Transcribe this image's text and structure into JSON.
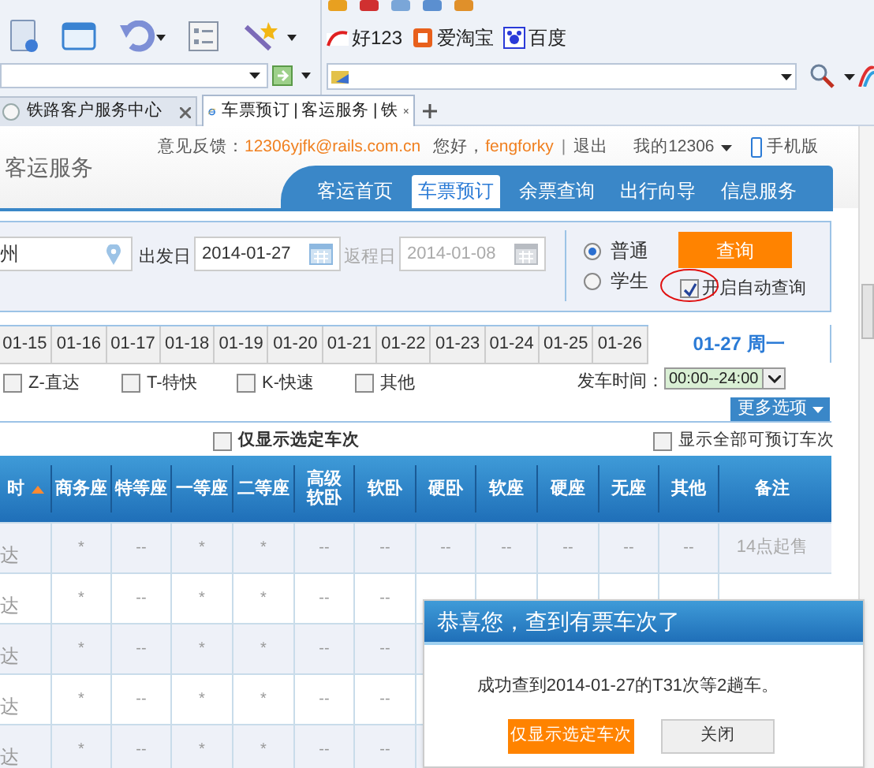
{
  "browser": {
    "links": [
      {
        "label": "好123"
      },
      {
        "label": "爱淘宝"
      },
      {
        "label": "百度"
      }
    ],
    "tabs": [
      {
        "label": "铁路客户服务中心",
        "selected": false
      },
      {
        "label": "车票预订 | 客运服务 | 铁",
        "selected": true
      }
    ]
  },
  "header": {
    "title": "客运服务",
    "feedback_label": "意见反馈：",
    "feedback_email": "12306yjfk@rails.com.cn",
    "greeting": "您好，",
    "username": "fengforky",
    "separator": "|",
    "logout": "退出",
    "my_account": "我的12306",
    "mobile": "手机版",
    "nav": [
      {
        "label": "客运首页",
        "selected": false
      },
      {
        "label": "车票预订",
        "selected": true
      },
      {
        "label": "余票查询",
        "selected": false
      },
      {
        "label": "出行向导",
        "selected": false
      },
      {
        "label": "信息服务",
        "selected": false
      }
    ]
  },
  "search": {
    "from": "州",
    "depart_label": "出发日",
    "depart_date": "2014-01-27",
    "return_label": "返程日",
    "return_date": "2014-01-08",
    "ticket_types": [
      {
        "label": "普通",
        "selected": true
      },
      {
        "label": "学生",
        "selected": false
      }
    ],
    "query_button": "查询",
    "auto_query": {
      "label": "开启自动查询",
      "checked": true
    }
  },
  "date_tabs": [
    {
      "label": "01-15",
      "selected": false
    },
    {
      "label": "01-16",
      "selected": false
    },
    {
      "label": "01-17",
      "selected": false
    },
    {
      "label": "01-18",
      "selected": false
    },
    {
      "label": "01-19",
      "selected": false
    },
    {
      "label": "01-20",
      "selected": false
    },
    {
      "label": "01-21",
      "selected": false
    },
    {
      "label": "01-22",
      "selected": false
    },
    {
      "label": "01-23",
      "selected": false
    },
    {
      "label": "01-24",
      "selected": false
    },
    {
      "label": "01-25",
      "selected": false
    },
    {
      "label": "01-26",
      "selected": false
    },
    {
      "label": "01-27 周一",
      "selected": true
    }
  ],
  "filters": [
    {
      "label": "Z-直达",
      "checked": false
    },
    {
      "label": "T-特快",
      "checked": false
    },
    {
      "label": "K-快速",
      "checked": false
    },
    {
      "label": "其他",
      "checked": false
    }
  ],
  "time_label": "发车时间：",
  "time_value": "00:00--24:00",
  "more_button": "更多选项",
  "only_selected": {
    "label": "仅显示选定车次",
    "checked": false
  },
  "show_all": {
    "label": "显示全部可预订车次",
    "checked": false
  },
  "table": {
    "columns": [
      "时",
      "商务座",
      "特等座",
      "一等座",
      "二等座",
      "高级软卧",
      "软卧",
      "硬卧",
      "软座",
      "硬座",
      "无座",
      "其他",
      "备注"
    ],
    "rows": [
      [
        "达",
        "*",
        "--",
        "*",
        "*",
        "--",
        "--",
        "--",
        "--",
        "--",
        "--",
        "--",
        "14点起售"
      ],
      [
        "达",
        "*",
        "--",
        "*",
        "*",
        "--",
        "--"
      ],
      [
        "达",
        "*",
        "--",
        "*",
        "*",
        "--",
        "--"
      ],
      [
        "达",
        "*",
        "--",
        "*",
        "*",
        "--",
        "--"
      ],
      [
        "达",
        "*",
        "--",
        "*",
        "*",
        "--",
        "--"
      ]
    ]
  },
  "dialog": {
    "title": "恭喜您，查到有票车次了",
    "message": "成功查到2014-01-27的T31次等2趟车。",
    "buttons": [
      {
        "label": "仅显示选定车次",
        "kind": "primary"
      },
      {
        "label": "关闭",
        "kind": "secondary"
      }
    ]
  }
}
